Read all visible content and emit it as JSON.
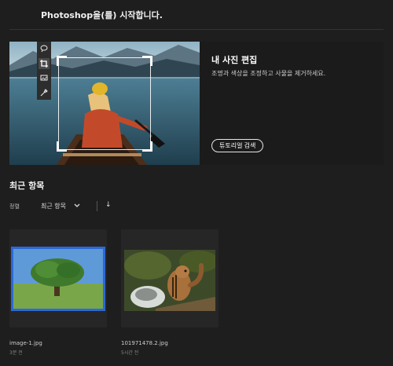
{
  "header": {
    "title": "Photoshop을(를) 시작합니다."
  },
  "hero": {
    "title": "내 사진 편집",
    "description": "조명과 색상을 조정하고 사물을 제거하세요.",
    "button_label": "튜토리얼 검색",
    "tools": [
      "lasso-icon",
      "crop-icon",
      "image-icon",
      "eyedropper-icon"
    ]
  },
  "recent": {
    "heading": "최근 항목",
    "sort_label": "정렬",
    "sort_value": "최근 항목",
    "sort_direction": "↓",
    "files": [
      {
        "name": "image-1.jpg",
        "time": "3분 전"
      },
      {
        "name": "101971478.2.jpg",
        "time": "5시간 전"
      }
    ]
  },
  "colors": {
    "accent": "#2c68d6",
    "background": "#1e1e1e"
  }
}
